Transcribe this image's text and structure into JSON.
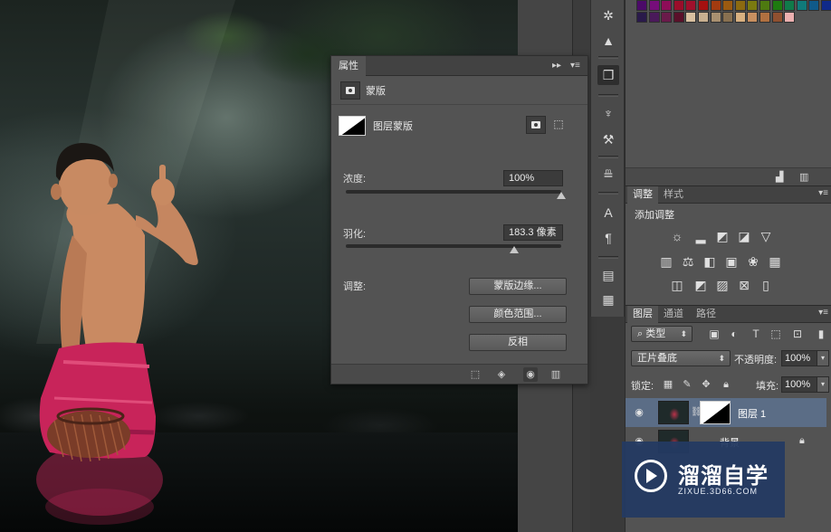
{
  "properties_panel": {
    "title": "属性",
    "mask_type": "蒙版",
    "layer_mask_label": "图层蒙版",
    "density_label": "浓度:",
    "density_value": "100%",
    "density_level": 1.0,
    "feather_label": "羽化:",
    "feather_value": "183.3 像素",
    "feather_level": 0.78,
    "adjust_label": "调整:",
    "buttons": [
      "蒙版边缘...",
      "颜色范围...",
      "反相"
    ],
    "footer_icons": [
      "load-selection-icon",
      "apply-mask-icon",
      "visibility-icon",
      "delete-icon"
    ]
  },
  "toolstrip": {
    "icons": [
      "compass-icon",
      "histogram-icon",
      "3d-cube-icon",
      "brush-presets-icon",
      "tool-presets-icon",
      "clone-source-icon",
      "character-icon",
      "paragraph-icon",
      "notes-icon",
      "info-icon"
    ]
  },
  "swatches": {
    "row1": [
      "#4b0a68",
      "#760d7a",
      "#8e0c58",
      "#9a0d2a",
      "#a0102c",
      "#a51010",
      "#a33b10",
      "#9a5a10",
      "#8c6a10",
      "#7a7a10",
      "#4e7a10",
      "#1e7a10",
      "#107a4a",
      "#107a7a",
      "#105a8a",
      "#102a8a"
    ],
    "row2": [
      "#2a1a4a",
      "#4a1a5a",
      "#6a1a4a",
      "#5a102a",
      "#d8c0a0",
      "#c8b090",
      "#a89070",
      "#887050",
      "#d8b080",
      "#c89060",
      "#b07040",
      "#905030",
      "#ecb0b0"
    ],
    "footer_icons": [
      "new-swatch-icon",
      "delete-swatch-icon"
    ]
  },
  "adjustments_panel": {
    "tabs": [
      "调整",
      "样式"
    ],
    "heading": "添加调整",
    "icons": [
      "brightness-icon",
      "levels-icon",
      "curves-icon",
      "exposure-icon",
      "vibrance-icon",
      "hue-saturation-icon",
      "color-balance-icon",
      "black-white-icon",
      "photo-filter-icon",
      "channel-mixer-icon",
      "color-lookup-icon",
      "invert-icon",
      "posterize-icon",
      "threshold-icon",
      "selective-color-icon",
      "gradient-map-icon"
    ]
  },
  "layers_panel": {
    "tabs": [
      "图层",
      "通道",
      "路径"
    ],
    "filter_kind": "类型",
    "blend_mode": "正片叠底",
    "opacity_label": "不透明度:",
    "opacity_value": "100%",
    "lock_label": "锁定:",
    "fill_label": "填充:",
    "fill_value": "100%",
    "layers": [
      {
        "name": "图层 1",
        "selected": true,
        "has_mask": true
      },
      {
        "name": "背景",
        "selected": false,
        "has_mask": false,
        "locked": true
      }
    ]
  },
  "watermark": {
    "brand": "溜溜自学",
    "url": "ZIXUE.3D66.COM"
  }
}
